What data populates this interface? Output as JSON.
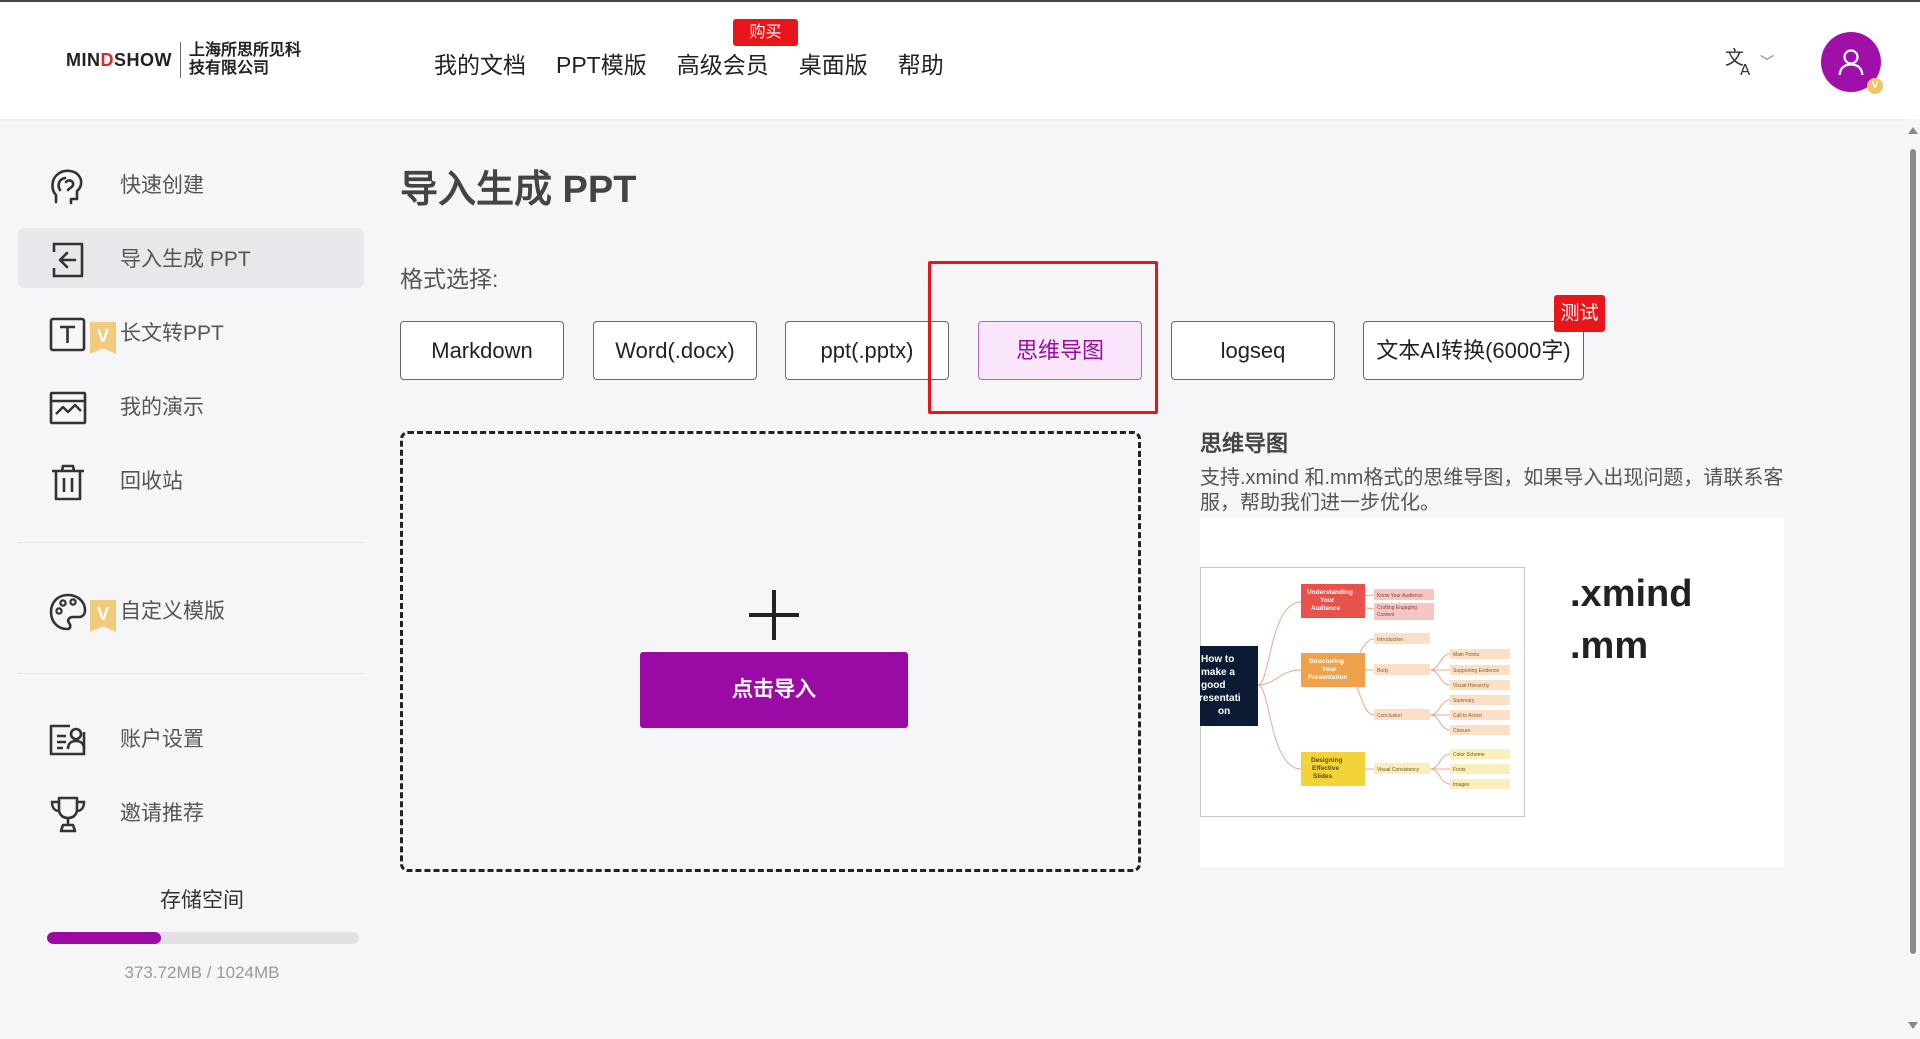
{
  "header": {
    "logo_brand": "MINDSHOW",
    "logo_brand_pre": "MIN",
    "logo_brand_accent": "D",
    "logo_brand_post": "SHOW",
    "logo_company": "上海所思所见科技有限公司",
    "nav": [
      {
        "label": "我的文档"
      },
      {
        "label": "PPT模版"
      },
      {
        "label": "高级会员"
      },
      {
        "label": "桌面版"
      },
      {
        "label": "帮助"
      }
    ],
    "buy_badge": "购买",
    "language_icon": "translate-icon",
    "avatar_badge": "V"
  },
  "sidebar": {
    "items": [
      {
        "label": "快速创建",
        "icon": "brain-icon"
      },
      {
        "label": "导入生成 PPT",
        "icon": "import-icon",
        "active": true
      },
      {
        "label": "长文转PPT",
        "icon": "text-icon",
        "vip": "V"
      },
      {
        "label": "我的演示",
        "icon": "presentation-icon"
      },
      {
        "label": "回收站",
        "icon": "trash-icon"
      },
      {
        "label": "自定义模版",
        "icon": "palette-icon",
        "vip": "V"
      },
      {
        "label": "账户设置",
        "icon": "account-icon"
      },
      {
        "label": "邀请推荐",
        "icon": "trophy-icon"
      }
    ],
    "storage": {
      "title": "存储空间",
      "usage_text": "373.72MB / 1024MB",
      "used_fraction": 0.365
    }
  },
  "main": {
    "title": "导入生成 PPT",
    "format_label": "格式选择:",
    "formats": [
      {
        "label": "Markdown"
      },
      {
        "label": "Word(.docx)"
      },
      {
        "label": "ppt(.pptx)"
      },
      {
        "label": "思维导图",
        "selected": true
      },
      {
        "label": "logseq"
      },
      {
        "label": "文本AI转换(6000字)"
      }
    ],
    "test_badge": "测试",
    "import_button": "点击导入",
    "info": {
      "title": "思维导图",
      "description": "支持.xmind 和.mm格式的思维导图，如果导入出现问题，请联系客服，帮助我们进一步优化。",
      "extensions": [
        ".xmind",
        ".mm"
      ]
    },
    "mindmap_preview": {
      "root": [
        "How to",
        "make a",
        "good",
        "resentati",
        "on"
      ],
      "branches": [
        {
          "label": [
            "Understanding",
            "Your",
            "Audience"
          ],
          "children": [
            "Know Your Audience",
            "Crafting Engaging Content"
          ]
        },
        {
          "label": [
            "Structuring",
            "Your",
            "Presentation"
          ],
          "children": [
            "Introduction",
            "Body",
            "Conclusion"
          ],
          "leaves": [
            "Main Points",
            "Supporting Evidence",
            "Visual Hierarchy",
            "Summary",
            "Call to Action",
            "Closure"
          ]
        },
        {
          "label": [
            "Designing",
            "Effective",
            "Slides"
          ],
          "children": [
            "Visual Consistency"
          ],
          "leaves": [
            "Color Scheme",
            "Fonts",
            "Images"
          ]
        }
      ]
    }
  },
  "colors": {
    "brand_purple": "#9b0aa5",
    "alert_red": "#e8161a",
    "vip_gold": "#f2cb7a"
  }
}
